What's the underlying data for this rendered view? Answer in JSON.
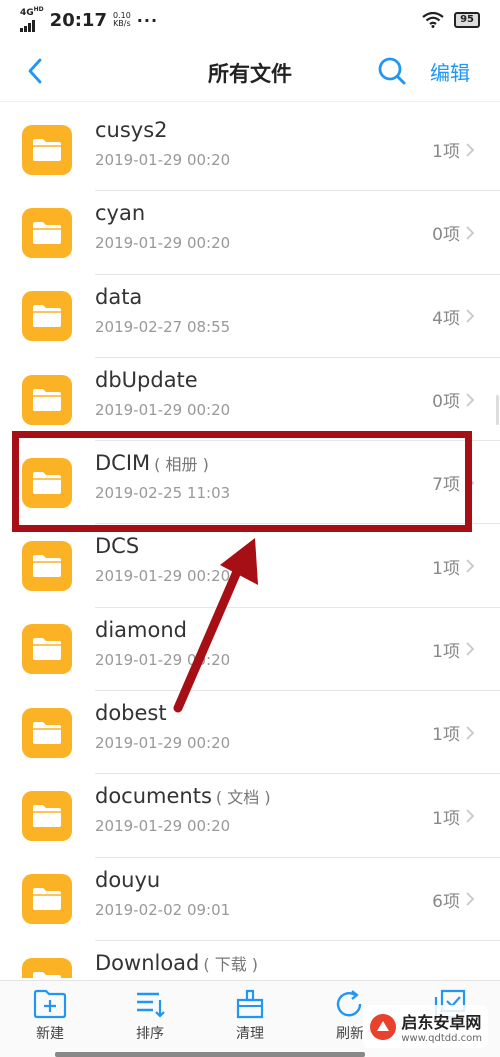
{
  "status_bar": {
    "network": "4G",
    "network_sub": "HD",
    "time": "20:17",
    "speed_value": "0.10",
    "speed_unit": "KB/s",
    "dots": "···",
    "battery": "95"
  },
  "header": {
    "title": "所有文件",
    "edit_label": "编辑"
  },
  "files": [
    {
      "name": "cusys2",
      "tag": "",
      "date": "2019-01-29 00:20",
      "count": "1项"
    },
    {
      "name": "cyan",
      "tag": "",
      "date": "2019-01-29 00:20",
      "count": "0项"
    },
    {
      "name": "data",
      "tag": "",
      "date": "2019-02-27 08:55",
      "count": "4项"
    },
    {
      "name": "dbUpdate",
      "tag": "",
      "date": "2019-01-29 00:20",
      "count": "0项"
    },
    {
      "name": "DCIM",
      "tag": "( 相册 )",
      "date": "2019-02-25 11:03",
      "count": "7项"
    },
    {
      "name": "DCS",
      "tag": "",
      "date": "2019-01-29 00:20",
      "count": "1项"
    },
    {
      "name": "diamond",
      "tag": "",
      "date": "2019-01-29 00:20",
      "count": "1项"
    },
    {
      "name": "dobest",
      "tag": "",
      "date": "2019-01-29 00:20",
      "count": "1项"
    },
    {
      "name": "documents",
      "tag": "( 文档 )",
      "date": "2019-01-29 00:20",
      "count": "1项"
    },
    {
      "name": "douyu",
      "tag": "",
      "date": "2019-02-02 09:01",
      "count": "6项"
    },
    {
      "name": "Download",
      "tag": "( 下载 )",
      "date": "",
      "count": ""
    }
  ],
  "toolbar": {
    "new_label": "新建",
    "sort_label": "排序",
    "clean_label": "清理",
    "refresh_label": "刷新"
  },
  "watermark": {
    "name": "启东安卓网",
    "url": "www.qdtdd.com"
  },
  "colors": {
    "accent": "#2196f3",
    "folder": "#fbb224",
    "annotation": "#a50f15"
  }
}
